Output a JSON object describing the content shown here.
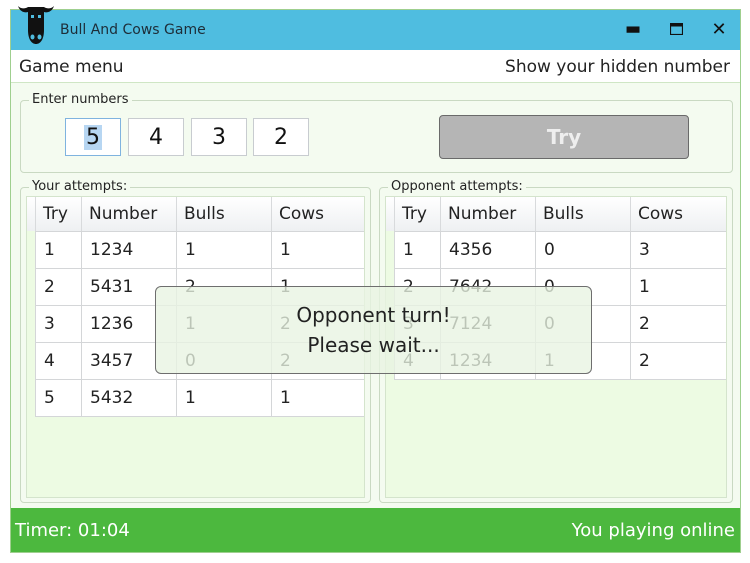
{
  "window": {
    "title": "Bull And Cows Game",
    "logo_icon": "bull-head-icon",
    "controls": [
      "minimize-icon",
      "maximize-icon",
      "close-icon"
    ]
  },
  "menu": {
    "game_menu": "Game menu",
    "show_hidden": "Show your hidden number"
  },
  "enter": {
    "label": "Enter numbers",
    "digits": [
      "5",
      "4",
      "3",
      "2"
    ],
    "try_label": "Try"
  },
  "your_attempts": {
    "label": "Your attempts:",
    "columns": [
      "Try",
      "Number",
      "Bulls",
      "Cows"
    ],
    "rows": [
      [
        "1",
        "1234",
        "1",
        "1"
      ],
      [
        "2",
        "5431",
        "2",
        "1"
      ],
      [
        "3",
        "1236",
        "1",
        "2"
      ],
      [
        "4",
        "3457",
        "0",
        "2"
      ],
      [
        "5",
        "5432",
        "1",
        "1"
      ]
    ]
  },
  "opponent_attempts": {
    "label": "Opponent attempts:",
    "columns": [
      "Try",
      "Number",
      "Bulls",
      "Cows"
    ],
    "rows": [
      [
        "1",
        "4356",
        "0",
        "3"
      ],
      [
        "2",
        "7642",
        "0",
        "1"
      ],
      [
        "3",
        "7124",
        "0",
        "2"
      ],
      [
        "4",
        "1234",
        "1",
        "2"
      ]
    ]
  },
  "overlay": {
    "line1": "Opponent turn!",
    "line2": "Please wait..."
  },
  "status": {
    "timer": "Timer:  01:04",
    "mode": "You playing online"
  },
  "colors": {
    "titlebar": "#4fbde0",
    "statusbar": "#4cb83e",
    "background": "#f4fbf0",
    "try_button": "#b5b5b5"
  }
}
